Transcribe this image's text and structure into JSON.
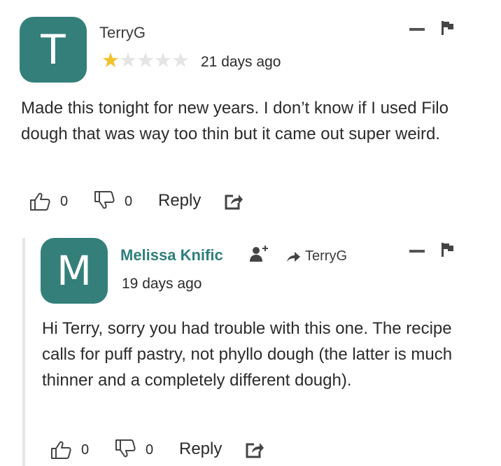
{
  "colors": {
    "avatar_teal": "#347f7a",
    "star_gold": "#f2c12e",
    "star_empty": "#e5e5e5",
    "author_teal": "#2e7f7b"
  },
  "comment": {
    "avatar_letter": "T",
    "author": "TerryG",
    "rating": 1,
    "rating_max": 5,
    "time": "21 days ago",
    "text": "Made this tonight for new years. I don’t know if I used Filo dough that was way too thin but it came out super weird.",
    "likes": "0",
    "dislikes": "0",
    "reply_label": "Reply",
    "icons": [
      "minus-icon",
      "flag-icon",
      "thumbs-up-icon",
      "thumbs-down-icon",
      "share-icon"
    ]
  },
  "reply": {
    "avatar_letter": "M",
    "author": "Melissa Knific",
    "reply_to": "TerryG",
    "time": "19 days ago",
    "text": "Hi Terry, sorry you had trouble with this one. The recipe calls for puff pastry, not phyllo dough (the latter is much thinner and a completely different dough).",
    "likes": "0",
    "dislikes": "0",
    "reply_label": "Reply",
    "icons": [
      "follow-user-icon",
      "reply-arrow-icon",
      "minus-icon",
      "flag-icon",
      "thumbs-up-icon",
      "thumbs-down-icon",
      "share-icon"
    ]
  }
}
